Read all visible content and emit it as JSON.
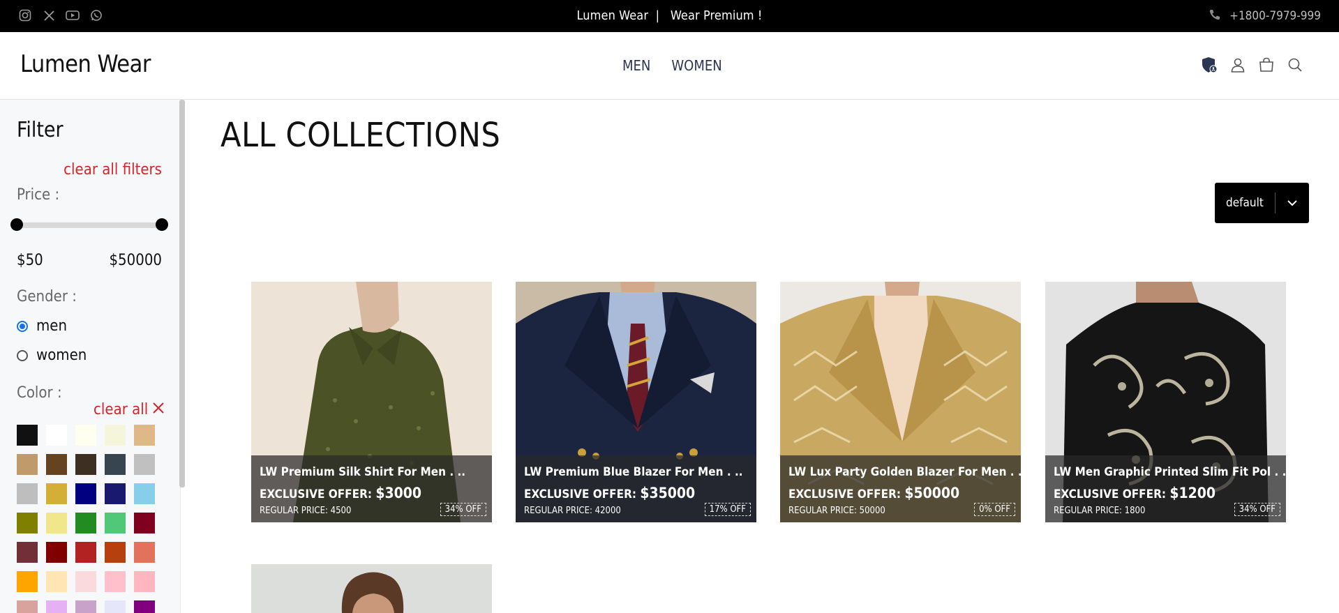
{
  "topbar": {
    "announcement": "Lumen Wear  |   Wear Premium !",
    "phone": "+1800-7979-999",
    "socials": [
      "instagram-icon",
      "x-icon",
      "youtube-icon",
      "whatsapp-icon"
    ]
  },
  "header": {
    "brand": "Lumen Wear",
    "nav": [
      "MEN",
      "WOMEN"
    ],
    "icons": [
      "shield-user-icon",
      "user-icon",
      "bag-icon",
      "search-icon"
    ]
  },
  "sidebar": {
    "title": "Filter",
    "clear_all_filters": "clear all filters",
    "price_label": "Price :",
    "price_min": "$50",
    "price_max": "$50000",
    "gender_label": "Gender :",
    "gender_options": [
      {
        "label": "men",
        "checked": true
      },
      {
        "label": "women",
        "checked": false
      }
    ],
    "color_label": "Color :",
    "clear_all": "clear all",
    "colors": [
      "#111111",
      "#ffffff",
      "#fffff0",
      "#f5f5dc",
      "#deb887",
      "#c19a6b",
      "#654321",
      "#3e2f23",
      "#36454f",
      "#c0c0c0",
      "#bebebe",
      "#d4af37",
      "#000080",
      "#191970",
      "#87ceeb",
      "#808000",
      "#f0e68c",
      "#228b22",
      "#50c878",
      "#800020",
      "#722f37",
      "#800000",
      "#b22222",
      "#b7410e",
      "#e2725b",
      "#ffa500",
      "#ffe5b4",
      "#fadadd",
      "#ffc0cb",
      "#ffb6c1",
      "#d8a39d",
      "#e6b0f5",
      "#c8a2c8",
      "#e6e6fa",
      "#800080"
    ]
  },
  "main": {
    "title": "ALL COLLECTIONS",
    "sort_value": "default",
    "products": [
      {
        "name": "LW Premium Silk Shirt For Men . ..",
        "offer_label": "EXCLUSIVE OFFER:",
        "offer_price": "$3000",
        "regular": "REGULAR PRICE: 4500",
        "discount": "34% OFF"
      },
      {
        "name": "LW Premium Blue Blazer For Men . ..",
        "offer_label": "EXCLUSIVE OFFER:",
        "offer_price": "$35000",
        "regular": "REGULAR PRICE: 42000",
        "discount": "17% OFF"
      },
      {
        "name": "LW Lux Party Golden Blazer For Men . ..",
        "offer_label": "EXCLUSIVE OFFER:",
        "offer_price": "$50000",
        "regular": "REGULAR PRICE: 50000",
        "discount": "0% OFF"
      },
      {
        "name": "LW Men Graphic Printed Slim Fit Pol . ..",
        "offer_label": "EXCLUSIVE OFFER:",
        "offer_price": "$1200",
        "regular": "REGULAR PRICE: 1800",
        "discount": "34% OFF"
      }
    ]
  }
}
